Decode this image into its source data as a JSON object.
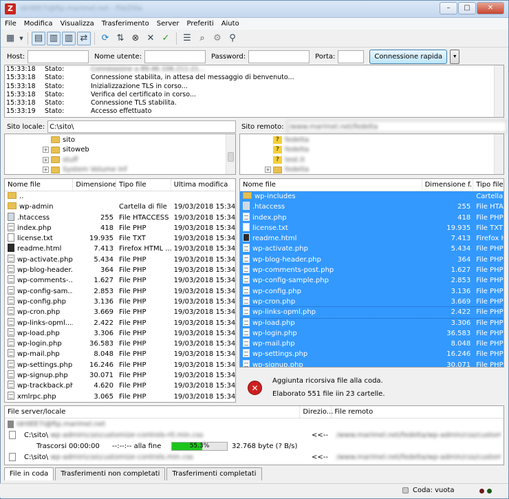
{
  "window": {
    "title": "ldr0EE7i@ftp.marimel.net - FileZilla",
    "icon_glyph": "Z",
    "min": "–",
    "max": "□",
    "close": "✕"
  },
  "menu": [
    "File",
    "Modifica",
    "Visualizza",
    "Trasferimento",
    "Server",
    "Preferiti",
    "Aiuto"
  ],
  "quickconnect": {
    "host_label": "Host:",
    "user_label": "Nome utente:",
    "pass_label": "Password:",
    "port_label": "Porta:",
    "button": "Connessione rapida",
    "dropdown": "▼"
  },
  "log": [
    {
      "time": "15:33:18",
      "type": "Stato:",
      "msg": "Connessione a 89.46.106.211:21...",
      "blur": true
    },
    {
      "time": "15:33:18",
      "type": "Stato:",
      "msg": "Connessione stabilita, in attesa del messaggio di benvenuto...",
      "blur": false
    },
    {
      "time": "15:33:18",
      "type": "Stato:",
      "msg": "Inizializzazione TLS in corso...",
      "blur": false
    },
    {
      "time": "15:33:18",
      "type": "Stato:",
      "msg": "Verifica del certificato in corso...",
      "blur": false
    },
    {
      "time": "15:33:18",
      "type": "Stato:",
      "msg": "Connessione TLS stabilita.",
      "blur": false
    },
    {
      "time": "15:33:19",
      "type": "Stato:",
      "msg": "Accesso effettuato",
      "blur": false
    }
  ],
  "local": {
    "site_label": "Sito locale:",
    "path": "C:\\sito\\",
    "tree": [
      {
        "name": "sito",
        "blur": false,
        "expander": ""
      },
      {
        "name": "sitoweb",
        "blur": false,
        "expander": "+"
      },
      {
        "name": "stuff",
        "blur": true,
        "expander": "+"
      },
      {
        "name": "System Volume Inf",
        "blur": true,
        "expander": "+"
      }
    ],
    "headers": [
      "Nome file",
      "Dimensione...",
      "Tipo file",
      "Ultima modifica"
    ],
    "files": [
      {
        "name": "..",
        "size": "",
        "type": "",
        "mod": "",
        "icon": "folder"
      },
      {
        "name": "wp-admin",
        "size": "",
        "type": "Cartella di file",
        "mod": "19/03/2018 15:34:08",
        "icon": "folder"
      },
      {
        "name": ".htaccess",
        "size": "255",
        "type": "File HTACCESS",
        "mod": "19/03/2018 15:34:05",
        "icon": "htaccess"
      },
      {
        "name": "index.php",
        "size": "418",
        "type": "File PHP",
        "mod": "19/03/2018 15:34:05",
        "icon": "php"
      },
      {
        "name": "license.txt",
        "size": "19.935",
        "type": "File TXT",
        "mod": "19/03/2018 15:34:05",
        "icon": "txt"
      },
      {
        "name": "readme.html",
        "size": "7.413",
        "type": "Firefox HTML ...",
        "mod": "19/03/2018 15:34:05",
        "icon": "html"
      },
      {
        "name": "wp-activate.php",
        "size": "5.434",
        "type": "File PHP",
        "mod": "19/03/2018 15:34:05",
        "icon": "php"
      },
      {
        "name": "wp-blog-header...",
        "size": "364",
        "type": "File PHP",
        "mod": "19/03/2018 15:34:05",
        "icon": "php"
      },
      {
        "name": "wp-comments-...",
        "size": "1.627",
        "type": "File PHP",
        "mod": "19/03/2018 15:34:05",
        "icon": "php"
      },
      {
        "name": "wp-config-sam...",
        "size": "2.853",
        "type": "File PHP",
        "mod": "19/03/2018 15:34:05",
        "icon": "php"
      },
      {
        "name": "wp-config.php",
        "size": "3.136",
        "type": "File PHP",
        "mod": "19/03/2018 15:34:05",
        "icon": "php"
      },
      {
        "name": "wp-cron.php",
        "size": "3.669",
        "type": "File PHP",
        "mod": "19/03/2018 15:34:05",
        "icon": "php"
      },
      {
        "name": "wp-links-opml....",
        "size": "2.422",
        "type": "File PHP",
        "mod": "19/03/2018 15:34:05",
        "icon": "php"
      },
      {
        "name": "wp-load.php",
        "size": "3.306",
        "type": "File PHP",
        "mod": "19/03/2018 15:34:05",
        "icon": "php"
      },
      {
        "name": "wp-login.php",
        "size": "36.583",
        "type": "File PHP",
        "mod": "19/03/2018 15:34:05",
        "icon": "php"
      },
      {
        "name": "wp-mail.php",
        "size": "8.048",
        "type": "File PHP",
        "mod": "19/03/2018 15:34:05",
        "icon": "php"
      },
      {
        "name": "wp-settings.php",
        "size": "16.246",
        "type": "File PHP",
        "mod": "19/03/2018 15:34:06",
        "icon": "php"
      },
      {
        "name": "wp-signup.php",
        "size": "30.071",
        "type": "File PHP",
        "mod": "19/03/2018 15:34:06",
        "icon": "php"
      },
      {
        "name": "wp-trackback.php",
        "size": "4.620",
        "type": "File PHP",
        "mod": "19/03/2018 15:34:06",
        "icon": "php"
      },
      {
        "name": "xmlrpc.php",
        "size": "3.065",
        "type": "File PHP",
        "mod": "19/03/2018 15:34:06",
        "icon": "php"
      }
    ]
  },
  "remote": {
    "site_label": "Sito remoto:",
    "path": "/www.marimel.net/fedelta",
    "tree": [
      {
        "name": "fedelta",
        "expander": ""
      },
      {
        "name": "fedelta",
        "expander": ""
      },
      {
        "name": "test.it",
        "expander": ""
      },
      {
        "name": "fedelta",
        "expander": "+"
      }
    ],
    "headers": [
      "Nome file",
      "Dimensione f...",
      "Tipo file"
    ],
    "files": [
      {
        "name": "wp-includes",
        "size": "",
        "type": "Cartella di",
        "icon": "folder"
      },
      {
        "name": ".htaccess",
        "size": "255",
        "type": "File HTACC",
        "icon": "htaccess"
      },
      {
        "name": "index.php",
        "size": "418",
        "type": "File PHP",
        "icon": "php"
      },
      {
        "name": "license.txt",
        "size": "19.935",
        "type": "File TXT",
        "icon": "txt"
      },
      {
        "name": "readme.html",
        "size": "7.413",
        "type": "Firefox HT",
        "icon": "html"
      },
      {
        "name": "wp-activate.php",
        "size": "5.434",
        "type": "File PHP",
        "icon": "php"
      },
      {
        "name": "wp-blog-header.php",
        "size": "364",
        "type": "File PHP",
        "icon": "php"
      },
      {
        "name": "wp-comments-post.php",
        "size": "1.627",
        "type": "File PHP",
        "icon": "php"
      },
      {
        "name": "wp-config-sample.php",
        "size": "2.853",
        "type": "File PHP",
        "icon": "php"
      },
      {
        "name": "wp-config.php",
        "size": "3.136",
        "type": "File PHP",
        "icon": "php"
      },
      {
        "name": "wp-cron.php",
        "size": "3.669",
        "type": "File PHP",
        "icon": "php"
      },
      {
        "name": "wp-links-opml.php",
        "size": "2.422",
        "type": "File PHP",
        "icon": "php"
      },
      {
        "name": "wp-load.php",
        "size": "3.306",
        "type": "File PHP",
        "icon": "php"
      },
      {
        "name": "wp-login.php",
        "size": "36.583",
        "type": "File PHP",
        "icon": "php"
      },
      {
        "name": "wp-mail.php",
        "size": "8.048",
        "type": "File PHP",
        "icon": "php"
      },
      {
        "name": "wp-settings.php",
        "size": "16.246",
        "type": "File PHP",
        "icon": "php"
      },
      {
        "name": "wp-signup.php",
        "size": "30.071",
        "type": "File PHP",
        "icon": "php"
      }
    ],
    "status_line1": "Aggiunta ricorsiva file alla coda.",
    "status_line2": "Elaborato 551 file iin 23 cartelle."
  },
  "queue": {
    "headers": [
      "File server/locale",
      "Direzio...",
      "File remoto"
    ],
    "server": "ldr0EE7i@ftp.marimel.net",
    "row1_local": "C:\\sito\\",
    "row1_local_blur": "wp-admin\\css\\customize-controls-rtl.min.css",
    "row1_dir": "<<--",
    "row1_remote": "/www.marimel.net/fedelta/wp-admin/css/customize-controls-rtl.min.css",
    "elapsed": "Trascorsi 00:00:00",
    "remaining": "--:--:-- alla fine",
    "progress": 55.3,
    "progress_label": "55.3%",
    "bytes": "32.768 byte (? B/s)",
    "row2_local": "C:\\sito\\",
    "row2_local_blur": "wp-admin\\css\\customize-controls.min.css",
    "row2_dir": "<<--",
    "row2_remote": "/www.marimel.net/fedelta/wp-admin/css/customize-controls.min.css"
  },
  "tabs": [
    "File in coda",
    "Trasferimenti non completati",
    "Trasferimenti completati"
  ],
  "statusbar": {
    "queue": "Coda: vuota"
  },
  "colors": {
    "selection": "#3399ff",
    "progress": "#1ec41e",
    "error": "#cc1f1f"
  }
}
